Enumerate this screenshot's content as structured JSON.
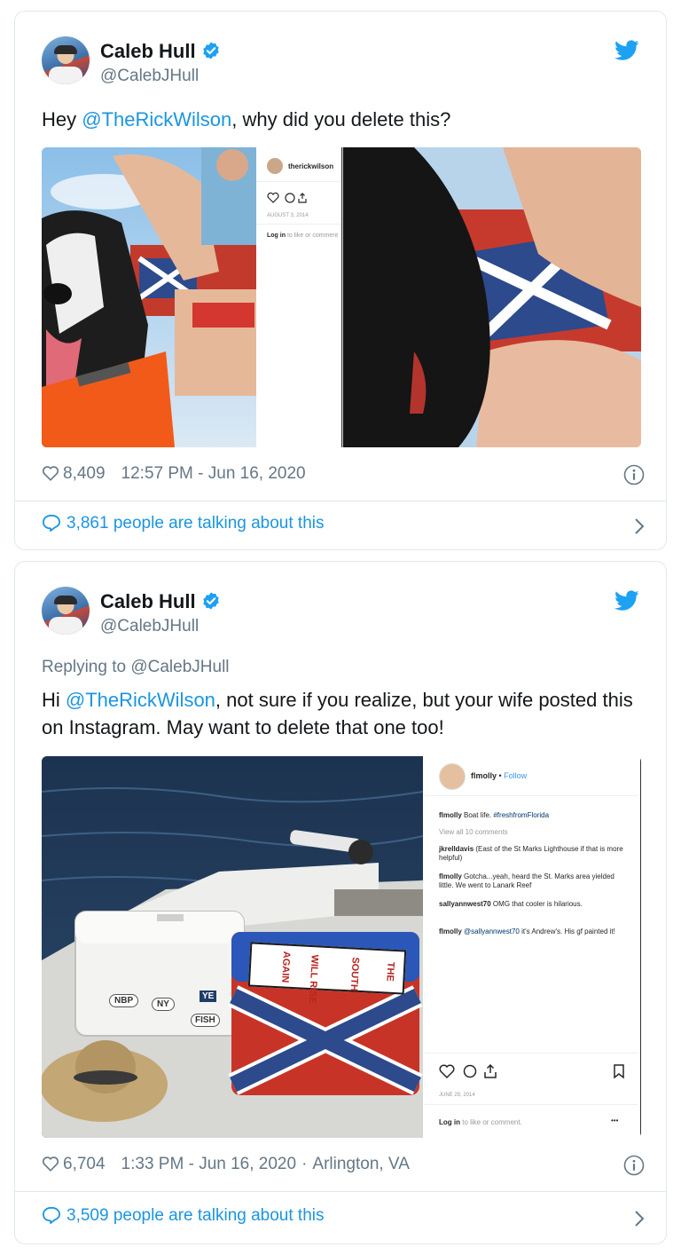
{
  "tweets": [
    {
      "author_name": "Caleb Hull",
      "author_handle": "@CalebJHull",
      "text_prefix": "Hey ",
      "text_mention": "@TheRickWilson",
      "text_suffix": ", why did you delete this?",
      "likes": "8,409",
      "timestamp": "12:57 PM - Jun 16, 2020",
      "talking": "3,861 people are talking about this",
      "instagram": {
        "username": "therickwilson",
        "date": "AUGUST 3, 2014",
        "login_link": "Log in",
        "login_rest": " to like or comment"
      }
    },
    {
      "author_name": "Caleb Hull",
      "author_handle": "@CalebJHull",
      "replying_prefix": "Replying to ",
      "replying_handle": "@CalebJHull",
      "text_prefix": "Hi ",
      "text_mention": "@TheRickWilson",
      "text_suffix": ", not sure if you realize, but your wife posted this on Instagram. May want to delete that one too!",
      "likes": "6,704",
      "timestamp": "1:33 PM - Jun 16, 2020",
      "location": "Arlington, VA",
      "talking": "3,509 people are talking about this",
      "instagram": {
        "username": "flmolly",
        "follow": "Follow",
        "caption_user": "flmolly",
        "caption_text": " Boat life. ",
        "caption_tag": "#freshfromFlorida",
        "view_all": "View all 10 comments",
        "comments": [
          {
            "user": "jkrelldavis",
            "text": " (East of the St Marks Lighthouse if that is more helpful)"
          },
          {
            "user": "flmolly",
            "text": " Gotcha...yeah, heard the St. Marks area yielded little. We went to Lanark Reef"
          },
          {
            "user": "sallyannwest70",
            "text": " OMG that cooler is hilarious."
          },
          {
            "user": "flmolly",
            "text": " ",
            "mention": "@sallyannwest70",
            "text2": " it's Andrew's. His gf painted it!"
          }
        ],
        "date": "JUNE 29, 2014",
        "login_link": "Log in",
        "login_rest": " to like or comment.",
        "more": "•••"
      },
      "cooler_text": [
        "THE",
        "SOUTH",
        "WILL RISE",
        "AGAIN"
      ],
      "cooler_stickers": [
        "NBP",
        "NY",
        "YE",
        "FISH"
      ]
    }
  ],
  "colors": {
    "accent": "#1b95e0",
    "muted": "#657786",
    "text": "#14171a",
    "border": "#e1e8ed"
  },
  "icons": [
    "verified-badge-icon",
    "twitter-bird-icon",
    "heart-icon",
    "info-icon",
    "speech-bubble-icon",
    "chevron-right-icon"
  ]
}
